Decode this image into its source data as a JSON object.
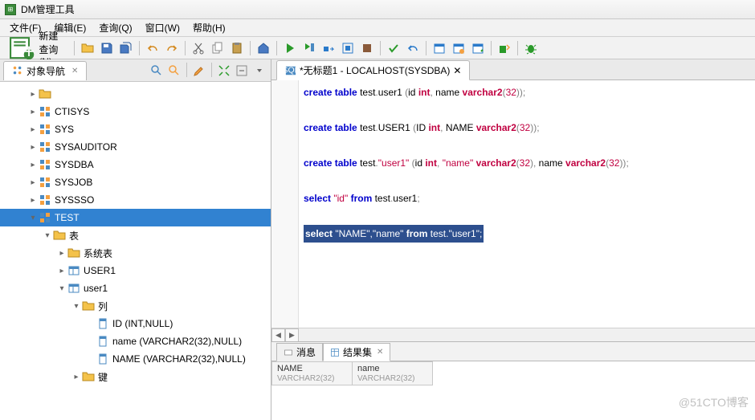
{
  "title": "DM管理工具",
  "menubar": [
    "文件(F)",
    "编辑(E)",
    "查询(Q)",
    "窗口(W)",
    "帮助(H)"
  ],
  "toolbar": {
    "new_query": "新建查询(N)"
  },
  "left_panel": {
    "tab": "对象导航",
    "tree": [
      {
        "ind": 1,
        "twist": "▸",
        "icon": "folder",
        "label": ""
      },
      {
        "ind": 1,
        "twist": "▸",
        "icon": "schema",
        "label": "CTISYS"
      },
      {
        "ind": 1,
        "twist": "▸",
        "icon": "schema",
        "label": "SYS"
      },
      {
        "ind": 1,
        "twist": "▸",
        "icon": "schema",
        "label": "SYSAUDITOR"
      },
      {
        "ind": 1,
        "twist": "▸",
        "icon": "schema",
        "label": "SYSDBA"
      },
      {
        "ind": 1,
        "twist": "▸",
        "icon": "schema",
        "label": "SYSJOB"
      },
      {
        "ind": 1,
        "twist": "▸",
        "icon": "schema",
        "label": "SYSSSO"
      },
      {
        "ind": 1,
        "twist": "▾",
        "icon": "schema",
        "label": "TEST",
        "sel": true
      },
      {
        "ind": 2,
        "twist": "▾",
        "icon": "folder",
        "label": "表"
      },
      {
        "ind": 3,
        "twist": "▸",
        "icon": "folder",
        "label": "系统表"
      },
      {
        "ind": 3,
        "twist": "▸",
        "icon": "table",
        "label": "USER1"
      },
      {
        "ind": 3,
        "twist": "▾",
        "icon": "table",
        "label": "user1"
      },
      {
        "ind": 4,
        "twist": "▾",
        "icon": "folder",
        "label": "列"
      },
      {
        "ind": 5,
        "twist": "",
        "icon": "column",
        "label": "ID (INT,NULL)"
      },
      {
        "ind": 5,
        "twist": "",
        "icon": "column",
        "label": "name (VARCHAR2(32),NULL)"
      },
      {
        "ind": 5,
        "twist": "",
        "icon": "column",
        "label": "NAME (VARCHAR2(32),NULL)"
      },
      {
        "ind": 4,
        "twist": "▸",
        "icon": "folder",
        "label": "键"
      }
    ]
  },
  "editor_tab": "*无标题1 - LOCALHOST(SYSDBA)",
  "code_lines": [
    {
      "t": "sql",
      "tokens": [
        [
          "kw",
          "create"
        ],
        [
          "sp",
          " "
        ],
        [
          "kw",
          "table"
        ],
        [
          "sp",
          " test"
        ],
        [
          "pn",
          "."
        ],
        [
          "sp",
          "user1 "
        ],
        [
          "pn",
          "("
        ],
        [
          "sp",
          "id "
        ],
        [
          "ty",
          "int"
        ],
        [
          "pn",
          ","
        ],
        [
          "sp",
          " name "
        ],
        [
          "ty",
          "varchar2"
        ],
        [
          "pn",
          "("
        ],
        [
          "num",
          "32"
        ],
        [
          "pn",
          "))"
        ],
        [
          "pn",
          ";"
        ]
      ]
    },
    {
      "t": "blank"
    },
    {
      "t": "sql",
      "tokens": [
        [
          "kw",
          "create"
        ],
        [
          "sp",
          " "
        ],
        [
          "kw",
          "table"
        ],
        [
          "sp",
          " test"
        ],
        [
          "pn",
          "."
        ],
        [
          "sp",
          "USER1 "
        ],
        [
          "pn",
          "("
        ],
        [
          "sp",
          "ID "
        ],
        [
          "ty",
          "int"
        ],
        [
          "pn",
          ","
        ],
        [
          "sp",
          " NAME "
        ],
        [
          "ty",
          "varchar2"
        ],
        [
          "pn",
          "("
        ],
        [
          "num",
          "32"
        ],
        [
          "pn",
          "))"
        ],
        [
          "pn",
          ";"
        ]
      ]
    },
    {
      "t": "blank"
    },
    {
      "t": "sql",
      "tokens": [
        [
          "kw",
          "create"
        ],
        [
          "sp",
          " "
        ],
        [
          "kw",
          "table"
        ],
        [
          "sp",
          " test"
        ],
        [
          "pn",
          "."
        ],
        [
          "str",
          "\"user1\""
        ],
        [
          "sp",
          " "
        ],
        [
          "pn",
          "("
        ],
        [
          "sp",
          "id "
        ],
        [
          "ty",
          "int"
        ],
        [
          "pn",
          ","
        ],
        [
          "sp",
          " "
        ],
        [
          "str",
          "\"name\""
        ],
        [
          "sp",
          " "
        ],
        [
          "ty",
          "varchar2"
        ],
        [
          "pn",
          "("
        ],
        [
          "num",
          "32"
        ],
        [
          "pn",
          "),"
        ],
        [
          "sp",
          " name "
        ],
        [
          "ty",
          "varchar2"
        ],
        [
          "pn",
          "("
        ],
        [
          "num",
          "32"
        ],
        [
          "pn",
          "))"
        ],
        [
          "pn",
          ";"
        ]
      ]
    },
    {
      "t": "blank"
    },
    {
      "t": "sql",
      "tokens": [
        [
          "kw",
          "select"
        ],
        [
          "sp",
          " "
        ],
        [
          "str",
          "\"id\""
        ],
        [
          "sp",
          " "
        ],
        [
          "kw",
          "from"
        ],
        [
          "sp",
          " test"
        ],
        [
          "pn",
          "."
        ],
        [
          "sp",
          "user1"
        ],
        [
          "pn",
          ";"
        ]
      ]
    },
    {
      "t": "blank"
    },
    {
      "t": "hl",
      "text": "select \"NAME\",\"name\" from test.\"user1\";"
    }
  ],
  "result_tabs": [
    "消息",
    "结果集"
  ],
  "result_cols": [
    {
      "name": "NAME",
      "type": "VARCHAR2(32)"
    },
    {
      "name": "name",
      "type": "VARCHAR2(32)"
    }
  ],
  "watermark": "@51CTO博客"
}
